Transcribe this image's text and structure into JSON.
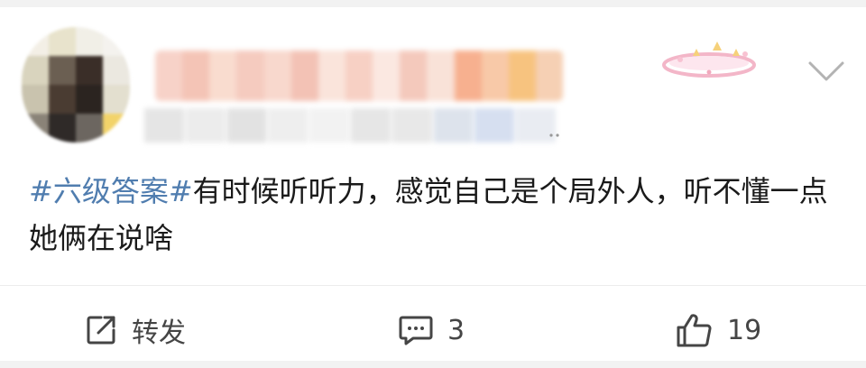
{
  "post": {
    "topic": "#六级答案#",
    "text": "有时候听听力，感觉自己是个局外人，听不懂一点她俩在说啥"
  },
  "actions": {
    "repost_label": "转发",
    "comment_count": "3",
    "like_count": "19"
  },
  "icons": {
    "repost": "share-box-icon",
    "comment": "comment-bubble-icon",
    "like": "thumbs-up-icon",
    "more": "chevron-down-icon",
    "badge": "decorative-badge-icon"
  },
  "colors": {
    "topic": "#507daf",
    "text": "#1a1a1a",
    "action": "#454545",
    "background": "#f2f2f2"
  }
}
